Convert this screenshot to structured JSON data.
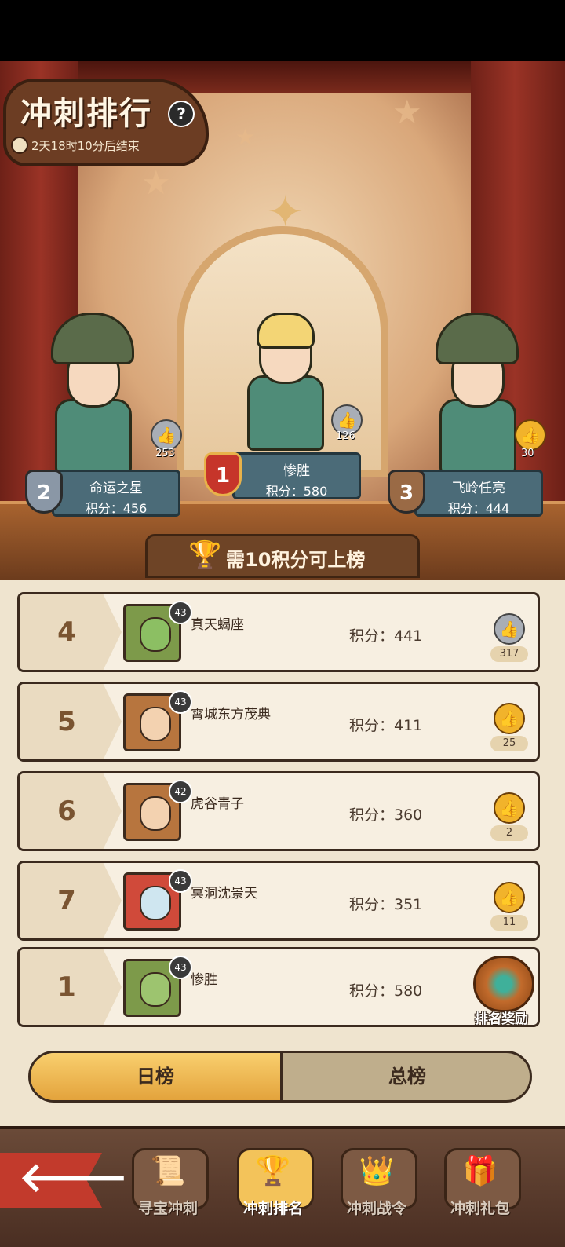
{
  "header": {
    "title": "冲刺排行",
    "help_icon": "question-mark-icon",
    "countdown": "2天18时10分后结束"
  },
  "podium": [
    {
      "rank": "2",
      "name": "命运之星",
      "score": "积分：456",
      "likes": "253",
      "like_color": "grey"
    },
    {
      "rank": "1",
      "name": "惨胜",
      "score": "积分：580",
      "likes": "126",
      "like_color": "grey"
    },
    {
      "rank": "3",
      "name": "飞岭任亮",
      "score": "积分：444",
      "likes": "30",
      "like_color": "gold"
    }
  ],
  "need_banner": "需10积分可上榜",
  "list": [
    {
      "rank": "4",
      "level": "43",
      "name": "真天蝎座",
      "score": "积分：441",
      "likes": "317",
      "like_color": "grey"
    },
    {
      "rank": "5",
      "level": "43",
      "name": "霄城东方茂典",
      "score": "积分：411",
      "likes": "25",
      "like_color": "gold"
    },
    {
      "rank": "6",
      "level": "42",
      "name": "虎谷青子",
      "score": "积分：360",
      "likes": "2",
      "like_color": "gold"
    },
    {
      "rank": "7",
      "level": "43",
      "name": "冥洞沈景天",
      "score": "积分：351",
      "likes": "11",
      "like_color": "gold"
    }
  ],
  "my_row": {
    "rank": "1",
    "level": "43",
    "name": "惨胜",
    "score": "积分：580",
    "reward_label": "排名奖励"
  },
  "tabs": {
    "daily": "日榜",
    "total": "总榜"
  },
  "nav": [
    {
      "label": "寻宝冲刺",
      "icon": "scroll-map-icon"
    },
    {
      "label": "冲刺排名",
      "icon": "trophy-icon"
    },
    {
      "label": "冲刺战令",
      "icon": "crown-icon"
    },
    {
      "label": "冲刺礼包",
      "icon": "gift-chest-icon"
    }
  ],
  "colors": {
    "accent": "#f1b32b",
    "panel": "#4b6b78",
    "wood": "#6c3d23"
  }
}
